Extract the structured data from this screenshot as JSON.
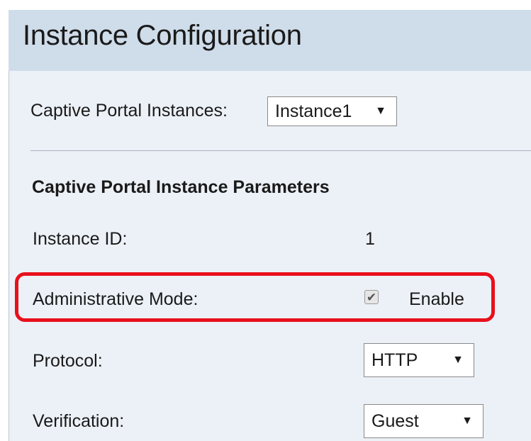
{
  "header": {
    "title": "Instance Configuration"
  },
  "instances": {
    "label": "Captive Portal Instances:",
    "selected": "Instance1"
  },
  "parameters": {
    "section_title": "Captive Portal Instance Parameters",
    "instance_id": {
      "label": "Instance ID:",
      "value": "1"
    },
    "admin_mode": {
      "label": "Administrative Mode:",
      "checkbox_label": "Enable",
      "checked": true
    },
    "protocol": {
      "label": "Protocol:",
      "selected": "HTTP"
    },
    "verification": {
      "label": "Verification:",
      "selected": "Guest"
    }
  },
  "colors": {
    "header_bg": "#cfdcea",
    "panel_bg": "#ecf1f7",
    "highlight": "#e8101c"
  },
  "icons": {
    "dropdown": "caret-down-icon",
    "checkmark": "checkmark-icon"
  }
}
